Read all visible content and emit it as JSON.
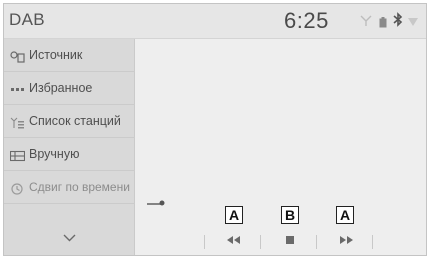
{
  "header": {
    "title": "DAB",
    "time": "6:25",
    "status_icons": [
      "antenna-icon",
      "battery-icon",
      "bluetooth-icon",
      "signal-icon"
    ]
  },
  "sidebar": {
    "items": [
      {
        "label": "Источник",
        "icon": "source-icon"
      },
      {
        "label": "Избранное",
        "icon": "favorites-icon"
      },
      {
        "label": "Список станций",
        "icon": "station-list-icon"
      },
      {
        "label": "Вручную",
        "icon": "manual-tuning-icon"
      },
      {
        "label": "Сдвиг по времени",
        "icon": "time-shift-icon",
        "state": "disabled"
      }
    ],
    "more_icon": "chevron-down-icon"
  },
  "controls": {
    "icons": [
      "rewind-icon",
      "stop-icon",
      "fast-forward-icon"
    ]
  },
  "callouts": {
    "a_left": "A",
    "b": "B",
    "a_right": "A"
  },
  "colors": {
    "background": "#eeeeee",
    "sidebar": "#d9d9d9",
    "text": "#4f4f4f"
  }
}
